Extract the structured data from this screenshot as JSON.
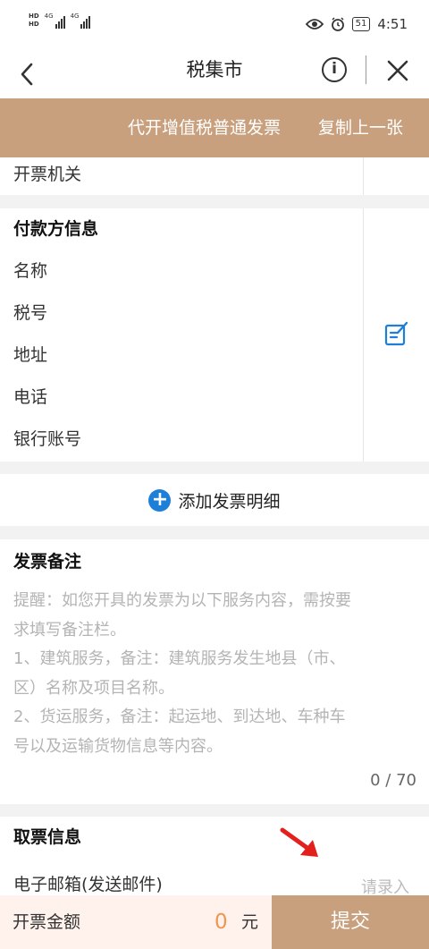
{
  "status_bar": {
    "sim1": "HD",
    "sim2": "HD",
    "net1": "4G",
    "net2": "4G",
    "battery": "51",
    "time": "4:51"
  },
  "nav": {
    "title": "税集市",
    "info_glyph": "i"
  },
  "actions": {
    "invoice_type": "代开增值税普通发票",
    "copy_last": "复制上一张"
  },
  "issuing_authority": {
    "label": "开票机关"
  },
  "payer": {
    "title": "付款方信息",
    "fields": [
      "名称",
      "税号",
      "地址",
      "电话",
      "银行账号"
    ]
  },
  "details": {
    "add_label": "添加发票明细"
  },
  "remarks": {
    "title": "发票备注",
    "hint_lines": [
      "提醒：如您开具的发票为以下服务内容，需按要",
      "求填写备注栏。",
      "1、建筑服务，备注：建筑服务发生地县（市、",
      "区）名称及项目名称。",
      "2、货运服务，备注：起运地、到达地、车种车",
      "号以及运输货物信息等内容。"
    ],
    "counter": "0 / 70"
  },
  "pickup": {
    "title": "取票信息",
    "email_label": "电子邮箱(发送邮件)",
    "email_placeholder": "请录入"
  },
  "footer": {
    "amount_label": "开票金额",
    "amount_value": "0",
    "amount_unit": "元",
    "submit_label": "提交"
  },
  "colors": {
    "accent": "#c9a07d",
    "plus": "#1e7fd8",
    "amount": "#f0954f",
    "arrow": "#e3201b"
  }
}
